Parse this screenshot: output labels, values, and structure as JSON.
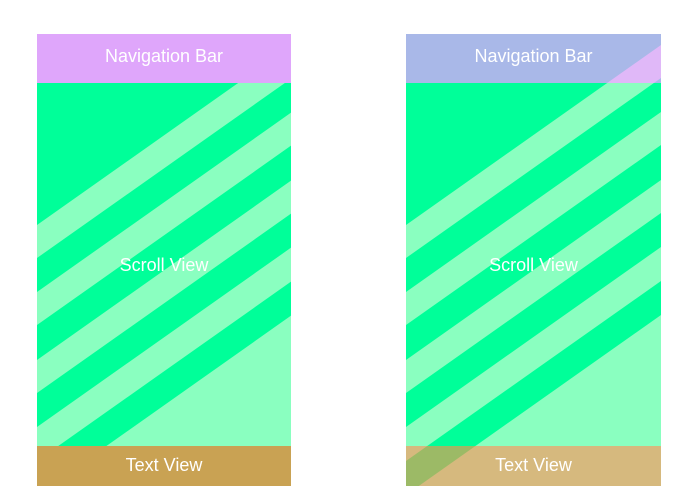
{
  "panels": [
    {
      "nav_label": "Navigation Bar",
      "scroll_label": "Scroll View",
      "text_label": "Text View",
      "colors": {
        "nav": [
          "#dfa6fb",
          "#dfa6fb"
        ],
        "scroll": [
          "#00ff99",
          "#8affc0"
        ],
        "text": [
          "#c9a253",
          "#c9a253"
        ]
      }
    },
    {
      "nav_label": "Navigation Bar",
      "scroll_label": "Scroll View",
      "text_label": "Text View",
      "colors": {
        "nav": [
          "#a9b8e8",
          "#e0b8f8"
        ],
        "scroll": [
          "#00ff99",
          "#8affc0"
        ],
        "text": [
          "#9cba66",
          "#d6b97e"
        ]
      }
    }
  ]
}
